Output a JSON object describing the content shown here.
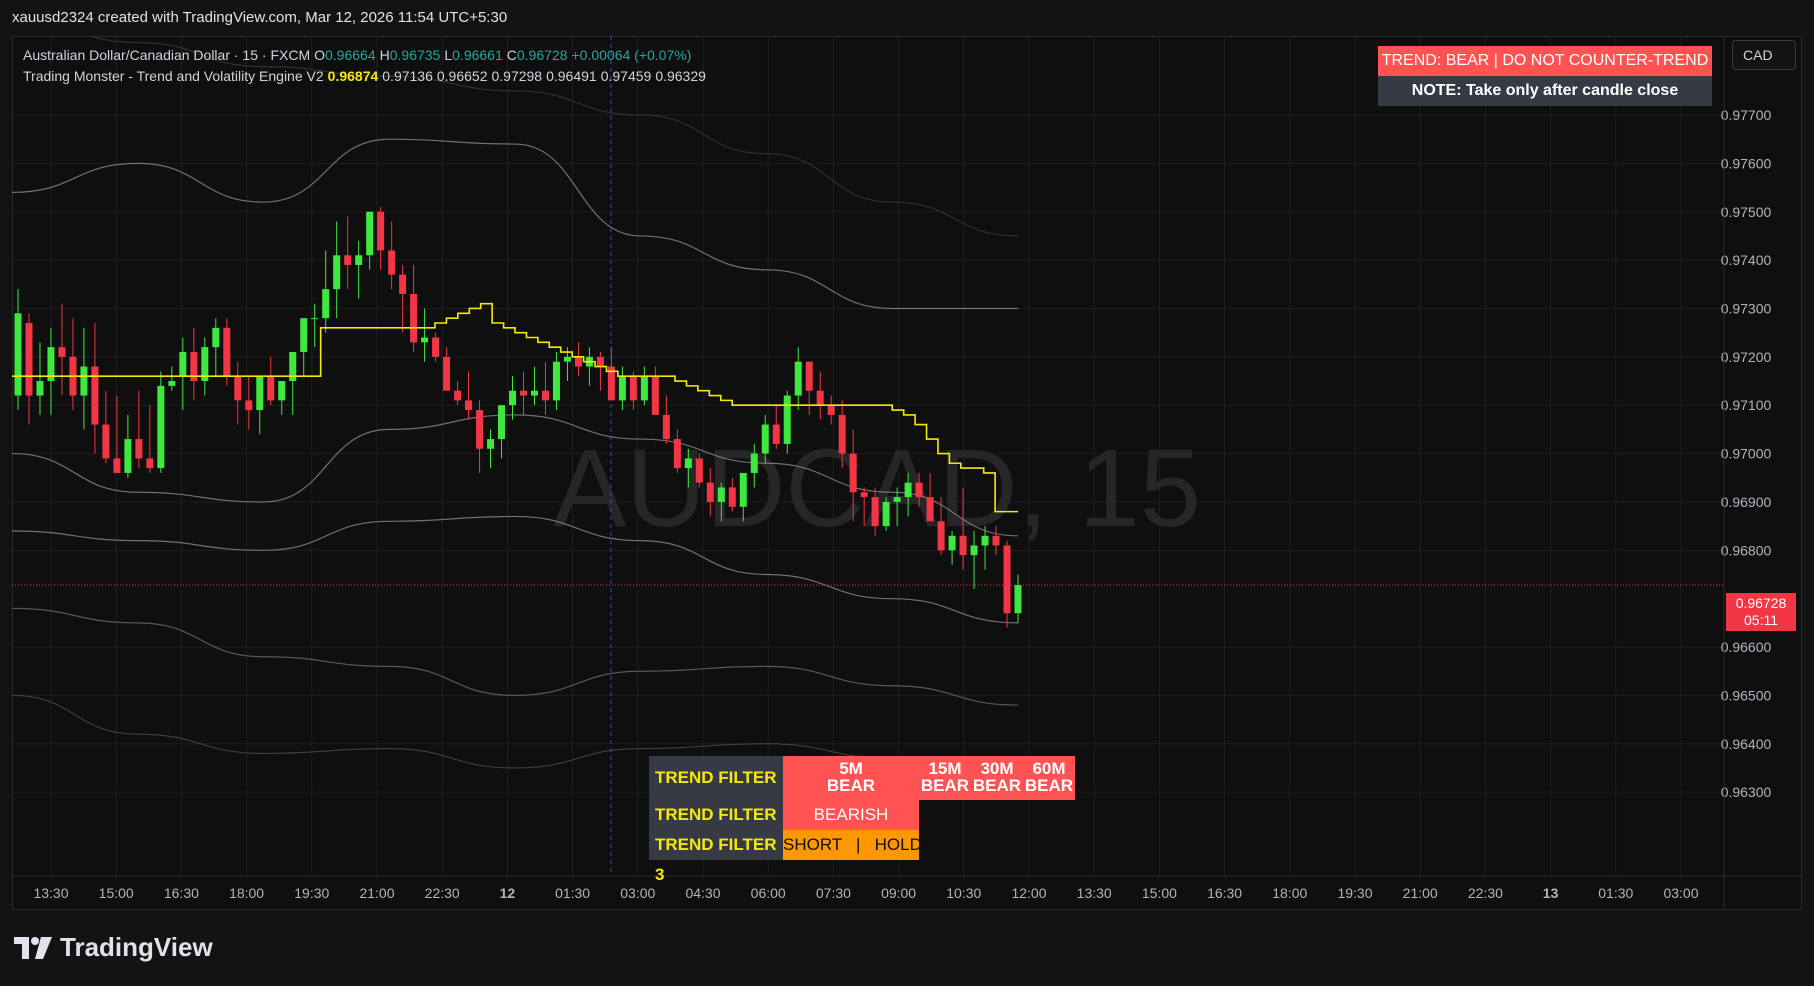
{
  "topbar": {
    "credit": "xauusd2324 created with TradingView.com, Mar 12, 2026 11:54 UTC+5:30"
  },
  "legend": {
    "symbol_line": {
      "name": "Australian Dollar/Canadian Dollar · 15 · FXCM",
      "o_label": "O",
      "o_value": "0.96664",
      "h_label": "H",
      "h_value": "0.96735",
      "l_label": "L",
      "l_value": "0.96661",
      "c_label": "C",
      "c_value": "0.96728",
      "change": "+0.00064 (+0.07%)"
    },
    "indicator_line": {
      "name": "Trading Monster - Trend and Volatility Engine V2",
      "v1": "0.96874",
      "v2": "0.97136",
      "v3": "0.96652",
      "v4": "0.97298",
      "v5": "0.96491",
      "v6": "0.97459",
      "v7": "0.96329"
    }
  },
  "watermark": "AUDCAD, 15",
  "badges": {
    "trend": "TREND: BEAR | DO NOT COUNTER-TREND",
    "note": "NOTE: Take only after candle close"
  },
  "currency_button": "CAD",
  "price_tag": {
    "price": "0.96728",
    "countdown": "05:11"
  },
  "colors": {
    "bull": "#3ee83e",
    "bear": "#f23645",
    "trend_line": "#f5e90a",
    "badge_red": "#ff5252",
    "badge_dark": "#363a45",
    "orange": "#ff9800"
  },
  "trend_filters": {
    "f1": {
      "label": "TREND FILTER 1",
      "m5": "5M",
      "m5_state": "BEAR",
      "m15": "15M",
      "m15_state": "BEAR",
      "m30": "30M",
      "m30_state": "BEAR",
      "m60": "60M",
      "m60_state": "BEAR"
    },
    "f2": {
      "label": "TREND FILTER 2",
      "state": "BEARISH"
    },
    "f3": {
      "label": "TREND FILTER 3",
      "state": "SHORT   |   HOLD"
    }
  },
  "footer": {
    "brand": "TradingView"
  },
  "chart_data": {
    "type": "candlestick",
    "y_ticks": [
      "0.97700",
      "0.97600",
      "0.97500",
      "0.97400",
      "0.97300",
      "0.97200",
      "0.97100",
      "0.97000",
      "0.96900",
      "0.96800",
      "0.96600",
      "0.96500",
      "0.96400",
      "0.96300"
    ],
    "x_ticks": [
      "13:30",
      "15:00",
      "16:30",
      "18:00",
      "19:30",
      "21:00",
      "22:30",
      "12",
      "01:30",
      "03:00",
      "04:30",
      "06:00",
      "07:30",
      "09:00",
      "10:30",
      "12:00",
      "13:30",
      "15:00",
      "16:30",
      "18:00",
      "19:30",
      "21:00",
      "22:30",
      "13",
      "01:30",
      "03:00"
    ],
    "ylim": [
      0.9623,
      0.9776
    ],
    "current_price": 0.96728,
    "candles": [
      [
        0.9712,
        0.9734,
        0.9709,
        0.9729
      ],
      [
        0.9727,
        0.9729,
        0.9706,
        0.9712
      ],
      [
        0.9712,
        0.9723,
        0.9708,
        0.9715
      ],
      [
        0.9715,
        0.9726,
        0.9708,
        0.9722
      ],
      [
        0.9722,
        0.9731,
        0.9712,
        0.972
      ],
      [
        0.972,
        0.9728,
        0.9709,
        0.9712
      ],
      [
        0.9712,
        0.9726,
        0.9705,
        0.9718
      ],
      [
        0.9718,
        0.9727,
        0.97,
        0.9706
      ],
      [
        0.9706,
        0.9713,
        0.9698,
        0.9699
      ],
      [
        0.9699,
        0.9712,
        0.9696,
        0.9696
      ],
      [
        0.9696,
        0.9708,
        0.9695,
        0.9703
      ],
      [
        0.9703,
        0.9713,
        0.9697,
        0.9699
      ],
      [
        0.9699,
        0.971,
        0.9696,
        0.9697
      ],
      [
        0.9697,
        0.9717,
        0.9696,
        0.9714
      ],
      [
        0.9714,
        0.9718,
        0.9713,
        0.9715
      ],
      [
        0.9716,
        0.9724,
        0.9709,
        0.9721
      ],
      [
        0.9721,
        0.9726,
        0.9711,
        0.9715
      ],
      [
        0.9715,
        0.9724,
        0.9712,
        0.9722
      ],
      [
        0.9722,
        0.9728,
        0.9716,
        0.9726
      ],
      [
        0.9726,
        0.9728,
        0.9714,
        0.9716
      ],
      [
        0.9716,
        0.9719,
        0.9706,
        0.9711
      ],
      [
        0.9711,
        0.9716,
        0.9705,
        0.9709
      ],
      [
        0.9709,
        0.9714,
        0.9704,
        0.9716
      ],
      [
        0.9716,
        0.972,
        0.971,
        0.9711
      ],
      [
        0.9711,
        0.9715,
        0.9708,
        0.9715
      ],
      [
        0.9715,
        0.9719,
        0.9708,
        0.9721
      ],
      [
        0.9721,
        0.9725,
        0.9716,
        0.9728
      ],
      [
        0.9728,
        0.9731,
        0.9722,
        0.9728
      ],
      [
        0.9728,
        0.9742,
        0.9725,
        0.9734
      ],
      [
        0.9734,
        0.9748,
        0.9728,
        0.9741
      ],
      [
        0.9741,
        0.9749,
        0.9734,
        0.9739
      ],
      [
        0.9739,
        0.9744,
        0.9732,
        0.9741
      ],
      [
        0.9741,
        0.975,
        0.9738,
        0.975
      ],
      [
        0.975,
        0.9751,
        0.9738,
        0.9742
      ],
      [
        0.9742,
        0.9748,
        0.9734,
        0.9737
      ],
      [
        0.9737,
        0.9739,
        0.9725,
        0.9733
      ],
      [
        0.9733,
        0.9739,
        0.9721,
        0.9723
      ],
      [
        0.9723,
        0.973,
        0.9719,
        0.9724
      ],
      [
        0.9724,
        0.9725,
        0.9719,
        0.972
      ],
      [
        0.972,
        0.9722,
        0.9716,
        0.9713
      ],
      [
        0.9713,
        0.9715,
        0.971,
        0.9711
      ],
      [
        0.9711,
        0.9717,
        0.9707,
        0.9709
      ],
      [
        0.9709,
        0.9711,
        0.9696,
        0.9701
      ],
      [
        0.9701,
        0.9705,
        0.9697,
        0.9703
      ],
      [
        0.9703,
        0.971,
        0.9699,
        0.971
      ],
      [
        0.971,
        0.9716,
        0.9707,
        0.9713
      ],
      [
        0.9713,
        0.9717,
        0.9708,
        0.9712
      ],
      [
        0.9712,
        0.9718,
        0.971,
        0.9713
      ],
      [
        0.9713,
        0.9719,
        0.9708,
        0.9711
      ],
      [
        0.9711,
        0.9721,
        0.9709,
        0.9719
      ],
      [
        0.9719,
        0.9722,
        0.9715,
        0.972
      ],
      [
        0.972,
        0.9723,
        0.9716,
        0.9718
      ],
      [
        0.9718,
        0.9722,
        0.9714,
        0.972
      ],
      [
        0.972,
        0.9721,
        0.9713,
        0.9718
      ],
      [
        0.9718,
        0.9722,
        0.9711,
        0.9711
      ],
      [
        0.9711,
        0.9718,
        0.9709,
        0.9716
      ],
      [
        0.9716,
        0.9717,
        0.9709,
        0.9711
      ],
      [
        0.9711,
        0.9718,
        0.971,
        0.9716
      ],
      [
        0.9716,
        0.9718,
        0.9708,
        0.9708
      ],
      [
        0.9708,
        0.9712,
        0.9702,
        0.9703
      ],
      [
        0.9703,
        0.9705,
        0.9696,
        0.9697
      ],
      [
        0.9697,
        0.9701,
        0.9693,
        0.9699
      ],
      [
        0.9699,
        0.97,
        0.9693,
        0.9694
      ],
      [
        0.9694,
        0.9697,
        0.9687,
        0.969
      ],
      [
        0.969,
        0.9694,
        0.9686,
        0.9693
      ],
      [
        0.9693,
        0.9695,
        0.9688,
        0.9689
      ],
      [
        0.9689,
        0.9696,
        0.9686,
        0.9696
      ],
      [
        0.9696,
        0.9702,
        0.9693,
        0.97
      ],
      [
        0.97,
        0.9708,
        0.9698,
        0.9706
      ],
      [
        0.9706,
        0.971,
        0.9701,
        0.9702
      ],
      [
        0.9702,
        0.9713,
        0.97,
        0.9712
      ],
      [
        0.9712,
        0.9722,
        0.9709,
        0.9719
      ],
      [
        0.9719,
        0.9719,
        0.9708,
        0.9713
      ],
      [
        0.9713,
        0.9717,
        0.9707,
        0.971
      ],
      [
        0.971,
        0.9712,
        0.9706,
        0.9708
      ],
      [
        0.9708,
        0.9711,
        0.9697,
        0.97
      ],
      [
        0.97,
        0.9705,
        0.9686,
        0.9692
      ],
      [
        0.9692,
        0.9693,
        0.9685,
        0.9691
      ],
      [
        0.9691,
        0.9693,
        0.9683,
        0.9685
      ],
      [
        0.9685,
        0.9691,
        0.9684,
        0.969
      ],
      [
        0.969,
        0.9693,
        0.9685,
        0.9691
      ],
      [
        0.9691,
        0.9696,
        0.9687,
        0.9694
      ],
      [
        0.9694,
        0.9696,
        0.9689,
        0.9691
      ],
      [
        0.9691,
        0.9696,
        0.9686,
        0.9686
      ],
      [
        0.9686,
        0.9691,
        0.9679,
        0.968
      ],
      [
        0.968,
        0.9684,
        0.9677,
        0.9683
      ],
      [
        0.9683,
        0.9693,
        0.9676,
        0.9679
      ],
      [
        0.9679,
        0.9684,
        0.9672,
        0.9681
      ],
      [
        0.9681,
        0.9685,
        0.9676,
        0.9683
      ],
      [
        0.9683,
        0.9685,
        0.9679,
        0.9681
      ],
      [
        0.9681,
        0.9682,
        0.9664,
        0.9667
      ],
      [
        0.9667,
        0.9675,
        0.9665,
        0.96728
      ]
    ],
    "trend_line": [
      0.9716,
      0.9716,
      0.9716,
      0.9716,
      0.9716,
      0.9716,
      0.9716,
      0.9716,
      0.9716,
      0.9716,
      0.9716,
      0.9716,
      0.9716,
      0.9716,
      0.9716,
      0.9716,
      0.9716,
      0.9716,
      0.9716,
      0.9716,
      0.9716,
      0.9716,
      0.9716,
      0.9716,
      0.9716,
      0.9716,
      0.9716,
      0.9726,
      0.9726,
      0.9726,
      0.9726,
      0.9726,
      0.9726,
      0.9726,
      0.9726,
      0.9726,
      0.9726,
      0.9727,
      0.9728,
      0.9729,
      0.973,
      0.9731,
      0.9727,
      0.9726,
      0.9725,
      0.9724,
      0.9723,
      0.9722,
      0.9721,
      0.972,
      0.9719,
      0.9718,
      0.9717,
      0.9716,
      0.9716,
      0.9716,
      0.9716,
      0.9716,
      0.9715,
      0.9714,
      0.9713,
      0.9712,
      0.9711,
      0.971,
      0.971,
      0.971,
      0.971,
      0.971,
      0.971,
      0.971,
      0.971,
      0.971,
      0.971,
      0.971,
      0.971,
      0.971,
      0.971,
      0.9709,
      0.9708,
      0.9706,
      0.9703,
      0.97,
      0.9698,
      0.9697,
      0.9697,
      0.9696,
      0.9688,
      0.9688,
      0.9688
    ],
    "bands": {
      "upper3": [
        0.979,
        0.9785,
        0.978,
        0.9778,
        0.9775,
        0.977,
        0.9762,
        0.9752,
        0.9745
      ],
      "upper2": [
        0.9754,
        0.976,
        0.9752,
        0.9765,
        0.9764,
        0.9745,
        0.9738,
        0.973,
        0.973
      ],
      "upper1": [
        0.97,
        0.9692,
        0.969,
        0.9705,
        0.9708,
        0.9703,
        0.9698,
        0.9692,
        0.9683
      ],
      "lower1": [
        0.9684,
        0.9682,
        0.968,
        0.9686,
        0.9687,
        0.9682,
        0.9675,
        0.967,
        0.9665
      ],
      "lower2": [
        0.9668,
        0.9665,
        0.9658,
        0.9656,
        0.965,
        0.9655,
        0.9656,
        0.9652,
        0.9648
      ],
      "lower3": [
        0.965,
        0.9642,
        0.9638,
        0.9639,
        0.9635,
        0.9639,
        0.964,
        0.9637,
        0.9633
      ]
    }
  }
}
